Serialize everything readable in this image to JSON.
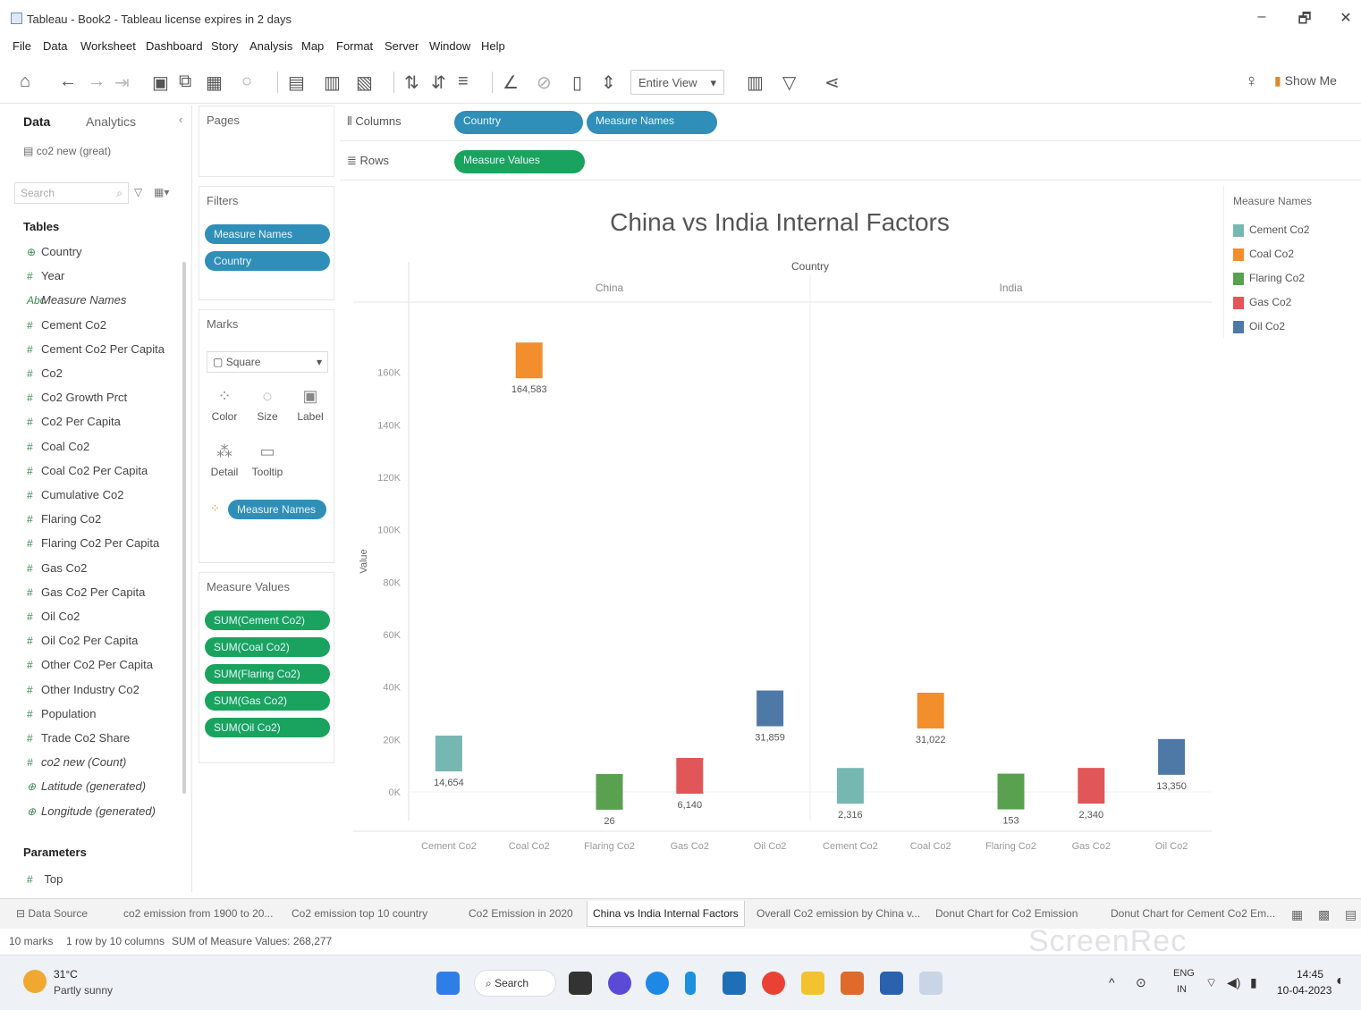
{
  "window": {
    "title": "Tableau - Book2 - Tableau license expires in 2 days",
    "controls": [
      "–",
      "🗗",
      "✕"
    ]
  },
  "menu": [
    "File",
    "Data",
    "Worksheet",
    "Dashboard",
    "Story",
    "Analysis",
    "Map",
    "Format",
    "Server",
    "Window",
    "Help"
  ],
  "toolbar": {
    "fit_mode": "Entire View",
    "show_me": "Show Me"
  },
  "data_pane": {
    "tabs": [
      "Data",
      "Analytics"
    ],
    "datasource": "co2 new (great)",
    "search_placeholder": "Search",
    "tables_header": "Tables",
    "fields": [
      {
        "icon": "⊕",
        "name": "Country",
        "italic": false
      },
      {
        "icon": "#",
        "name": "Year",
        "italic": false
      },
      {
        "icon": "Abc",
        "name": "Measure Names",
        "italic": true
      },
      {
        "icon": "#",
        "name": "Cement Co2",
        "italic": false
      },
      {
        "icon": "#",
        "name": "Cement Co2 Per Capita",
        "italic": false
      },
      {
        "icon": "#",
        "name": "Co2",
        "italic": false
      },
      {
        "icon": "#",
        "name": "Co2 Growth Prct",
        "italic": false
      },
      {
        "icon": "#",
        "name": "Co2 Per Capita",
        "italic": false
      },
      {
        "icon": "#",
        "name": "Coal Co2",
        "italic": false
      },
      {
        "icon": "#",
        "name": "Coal Co2 Per Capita",
        "italic": false
      },
      {
        "icon": "#",
        "name": "Cumulative Co2",
        "italic": false
      },
      {
        "icon": "#",
        "name": "Flaring Co2",
        "italic": false
      },
      {
        "icon": "#",
        "name": "Flaring Co2 Per Capita",
        "italic": false
      },
      {
        "icon": "#",
        "name": "Gas Co2",
        "italic": false
      },
      {
        "icon": "#",
        "name": "Gas Co2 Per Capita",
        "italic": false
      },
      {
        "icon": "#",
        "name": "Oil Co2",
        "italic": false
      },
      {
        "icon": "#",
        "name": "Oil Co2 Per Capita",
        "italic": false
      },
      {
        "icon": "#",
        "name": "Other Co2 Per Capita",
        "italic": false
      },
      {
        "icon": "#",
        "name": "Other Industry Co2",
        "italic": false
      },
      {
        "icon": "#",
        "name": "Population",
        "italic": false
      },
      {
        "icon": "#",
        "name": "Trade Co2 Share",
        "italic": false
      },
      {
        "icon": "#",
        "name": "co2 new (Count)",
        "italic": true
      },
      {
        "icon": "⊕",
        "name": "Latitude (generated)",
        "italic": true
      },
      {
        "icon": "⊕",
        "name": "Longitude (generated)",
        "italic": true
      }
    ],
    "parameters_header": "Parameters",
    "parameters": [
      {
        "icon": "#",
        "name": "Top"
      }
    ]
  },
  "cards": {
    "pages": "Pages",
    "filters": "Filters",
    "filter_pills": [
      "Measure Names",
      "Country"
    ],
    "marks": "Marks",
    "mark_type": "Square",
    "mark_buttons": [
      "Color",
      "Size",
      "Label",
      "Detail",
      "Tooltip"
    ],
    "color_pill": "Measure Names",
    "measure_values": "Measure Values",
    "measure_value_pills": [
      "SUM(Cement Co2)",
      "SUM(Coal Co2)",
      "SUM(Flaring Co2)",
      "SUM(Gas Co2)",
      "SUM(Oil Co2)"
    ]
  },
  "shelves": {
    "columns_label": "Columns",
    "columns_pills": [
      "Country",
      "Measure Names"
    ],
    "rows_label": "Rows",
    "rows_pills": [
      "Measure Values"
    ]
  },
  "chart_data": {
    "type": "scatter",
    "title": "China vs India Internal Factors",
    "column_header": "Country",
    "panes": [
      "China",
      "India"
    ],
    "categories": [
      "Cement Co2",
      "Coal Co2",
      "Flaring Co2",
      "Gas Co2",
      "Oil Co2"
    ],
    "ylabel": "Value",
    "yticks": [
      "0K",
      "10K",
      "20K",
      "40K",
      "60K",
      "80K",
      "100K",
      "120K",
      "140K",
      "160K"
    ],
    "series": [
      {
        "name": "China",
        "values": [
          14654,
          164583,
          26,
          6140,
          31859
        ],
        "labels": [
          "14,654",
          "164,583",
          "26",
          "6,140",
          "31,859"
        ]
      },
      {
        "name": "India",
        "values": [
          2316,
          31022,
          153,
          2340,
          13350
        ],
        "labels": [
          "2,316",
          "31,022",
          "153",
          "2,340",
          "13,350"
        ]
      }
    ],
    "colors": {
      "Cement Co2": "#76b7b2",
      "Coal Co2": "#f28e2b",
      "Flaring Co2": "#59a14f",
      "Gas Co2": "#e15759",
      "Oil Co2": "#4e79a7"
    }
  },
  "legend": {
    "title": "Measure Names",
    "items": [
      {
        "name": "Cement Co2",
        "color": "#76b7b2"
      },
      {
        "name": "Coal Co2",
        "color": "#f28e2b"
      },
      {
        "name": "Flaring Co2",
        "color": "#59a14f"
      },
      {
        "name": "Gas Co2",
        "color": "#e15759"
      },
      {
        "name": "Oil Co2",
        "color": "#4e79a7"
      }
    ]
  },
  "sheet_tabs": {
    "data_source": "Data Source",
    "tabs": [
      "co2 emission from 1900 to 20...",
      "Co2 emission top 10 country",
      "Co2 Emission in 2020",
      "China vs India Internal Factors",
      "Overall Co2 emission by China v...",
      "Donut Chart for Co2 Emission",
      "Donut Chart for Cement Co2 Em..."
    ],
    "active_index": 3
  },
  "status": {
    "marks": "10 marks",
    "rows_cols": "1 row by 10 columns",
    "sum": "SUM of Measure Values: 268,277"
  },
  "taskbar": {
    "weather_temp": "31°C",
    "weather_desc": "Partly sunny",
    "search": "Search",
    "lang": "ENG",
    "lang2": "IN",
    "time": "14:45",
    "date": "10-04-2023",
    "watermark": "ScreenRec"
  }
}
